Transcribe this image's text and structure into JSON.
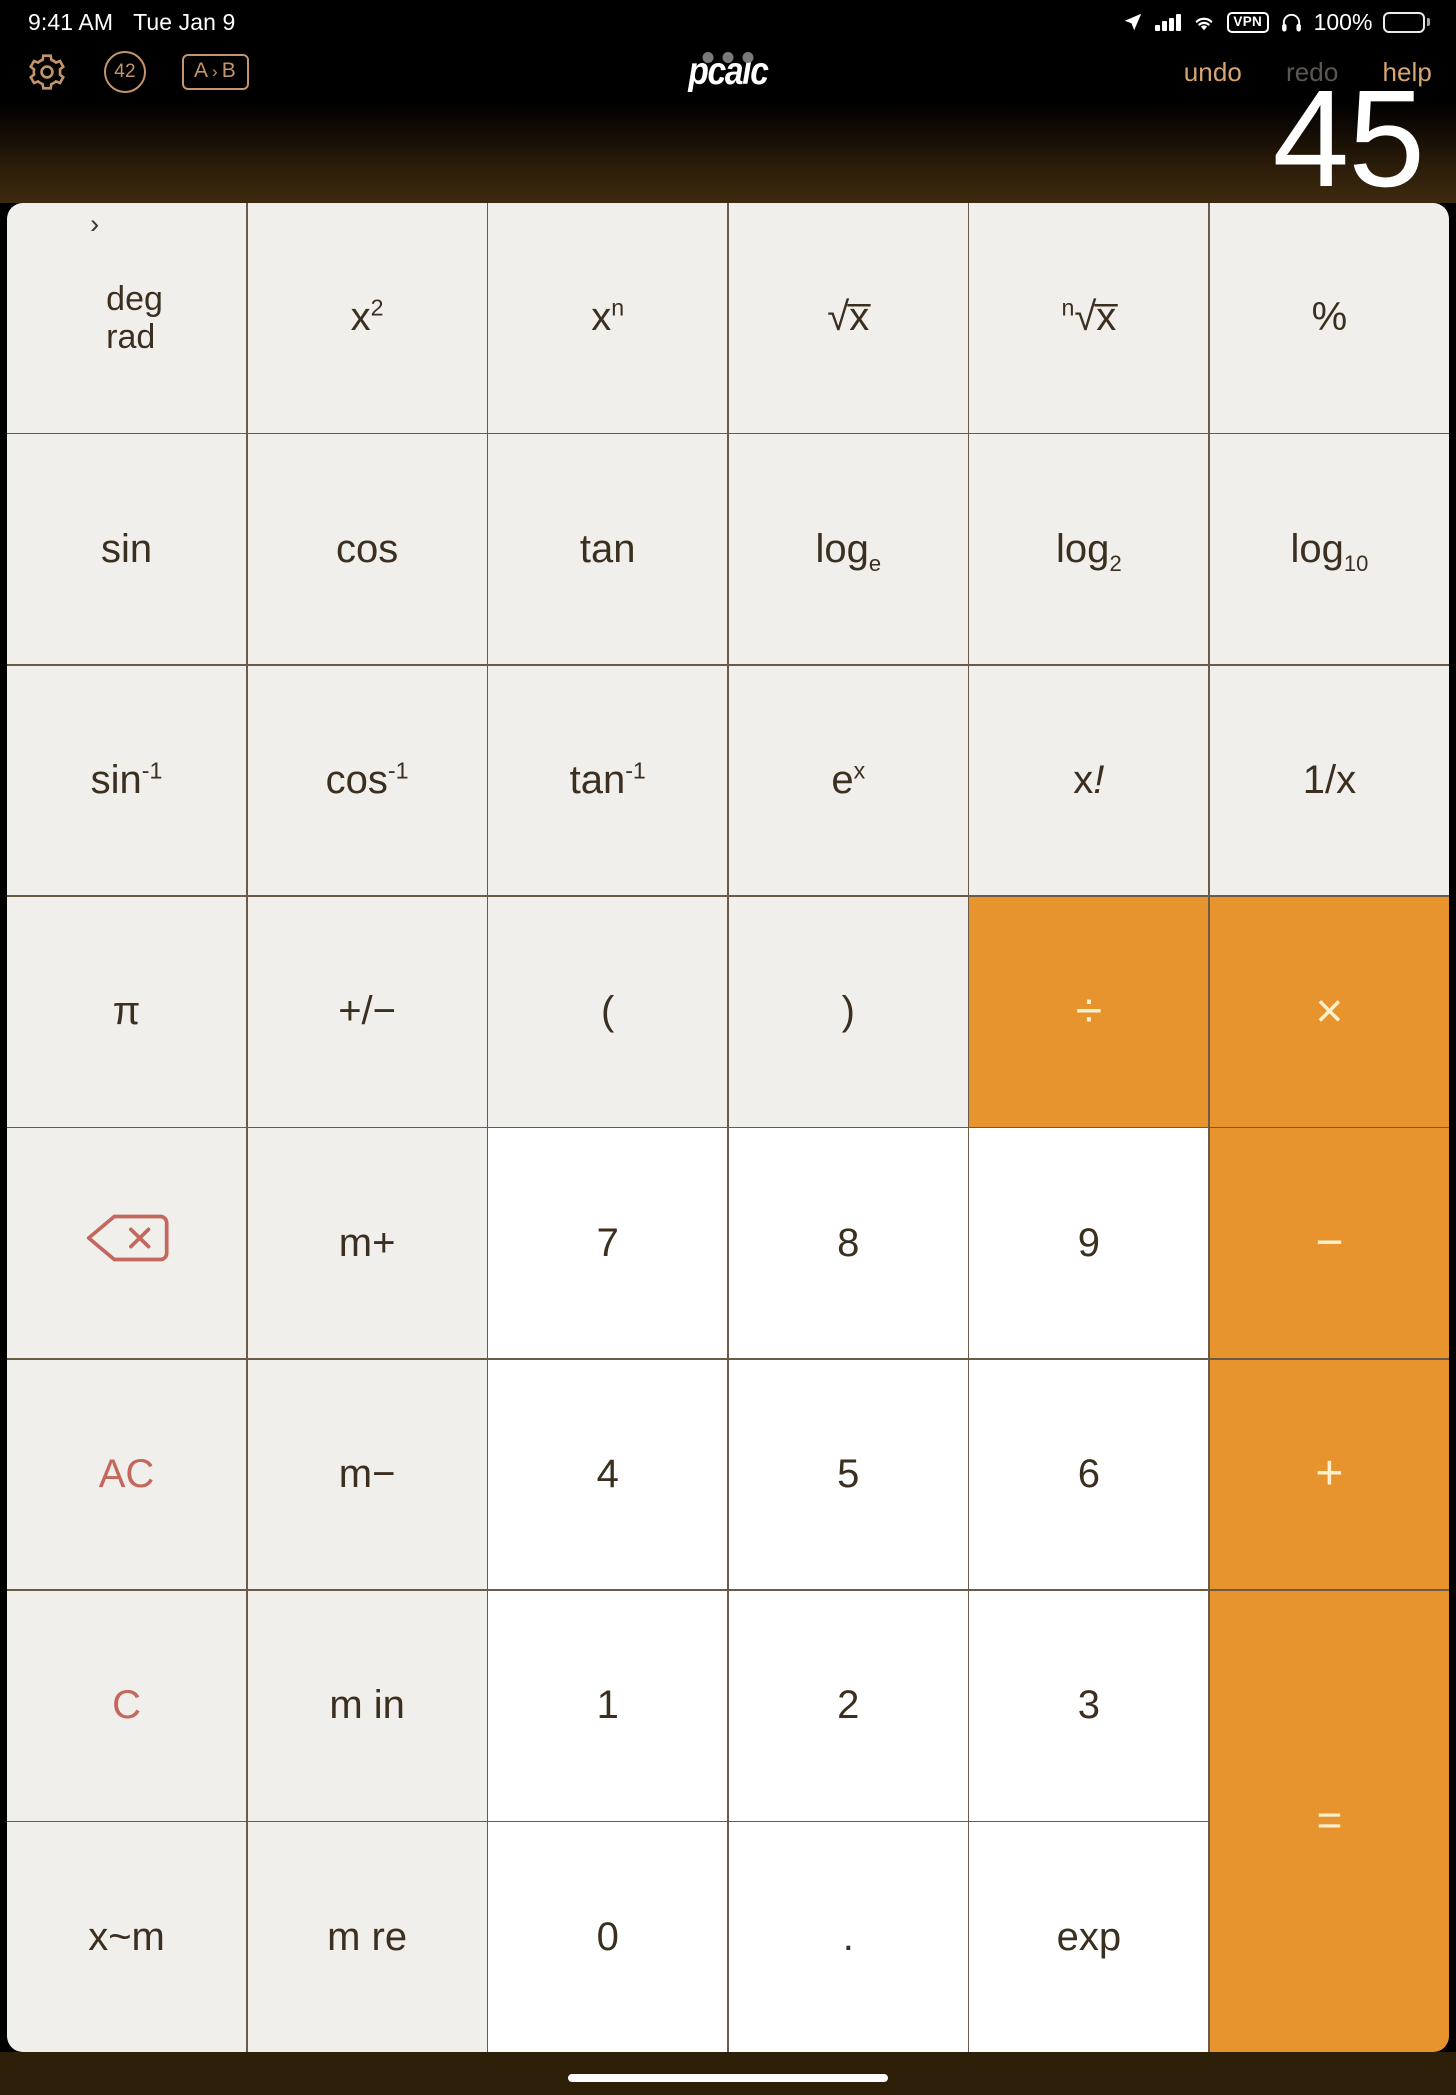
{
  "status_bar": {
    "time": "9:41 AM",
    "date": "Tue Jan 9",
    "battery_percent": "100%",
    "vpn_label": "VPN",
    "icons": [
      "location-arrow-icon",
      "cellular-signal-icon",
      "wifi-icon",
      "vpn-badge",
      "headphones-icon",
      "battery-icon"
    ]
  },
  "toolbar": {
    "settings_icon": "gear-icon",
    "constants_badge": "42",
    "conversion_label_a": "A",
    "conversion_chevron": "›",
    "conversion_label_b": "B",
    "app_title": "pcalc",
    "undo_label": "undo",
    "redo_label": "redo",
    "help_label": "help",
    "redo_disabled": true
  },
  "display": {
    "value": "45"
  },
  "colors": {
    "orange_key": "#e8942e",
    "orange_glyph": "#fdf0cf",
    "gray_key": "#f1efec",
    "white_key": "#ffffff",
    "key_text": "#3b2f20",
    "red_text": "#c4675c",
    "accent_tan": "#c4956b",
    "toolbar_tan": "#d8a472",
    "disabled_gray": "#5e5650",
    "grid_line": "#6a5b46",
    "bottom_bar": "#2e1f08"
  },
  "keypad": {
    "rows": [
      [
        {
          "name": "deg-rad-toggle",
          "type": "mode",
          "chevron": "›",
          "line1": "deg",
          "line2": "rad",
          "style": "gray"
        },
        {
          "name": "x-squared",
          "html": "x<sup>2</sup>",
          "style": "gray"
        },
        {
          "name": "x-to-the-n",
          "html": "x<sup>n</sup>",
          "style": "gray"
        },
        {
          "name": "square-root",
          "html": "√x̅",
          "style": "gray"
        },
        {
          "name": "nth-root",
          "html": "<sup>n</sup>√x̅",
          "style": "gray"
        },
        {
          "name": "percent",
          "html": "%",
          "style": "gray"
        }
      ],
      [
        {
          "name": "sin",
          "html": "sin",
          "style": "gray"
        },
        {
          "name": "cos",
          "html": "cos",
          "style": "gray"
        },
        {
          "name": "tan",
          "html": "tan",
          "style": "gray"
        },
        {
          "name": "log-e",
          "html": "log<sub>e</sub>",
          "style": "gray"
        },
        {
          "name": "log-2",
          "html": "log<sub>2</sub>",
          "style": "gray"
        },
        {
          "name": "log-10",
          "html": "log<sub>10</sub>",
          "style": "gray"
        }
      ],
      [
        {
          "name": "arcsin",
          "html": "sin<sup>-1</sup>",
          "style": "gray"
        },
        {
          "name": "arccos",
          "html": "cos<sup>-1</sup>",
          "style": "gray"
        },
        {
          "name": "arctan",
          "html": "tan<sup>-1</sup>",
          "style": "gray"
        },
        {
          "name": "e-to-the-x",
          "html": "e<sup>x</sup>",
          "style": "gray"
        },
        {
          "name": "factorial",
          "html": "x<i>!</i>",
          "style": "gray"
        },
        {
          "name": "reciprocal",
          "html": "1/x",
          "style": "gray"
        }
      ],
      [
        {
          "name": "pi",
          "html": "π",
          "style": "gray"
        },
        {
          "name": "plus-minus",
          "html": "+/−",
          "style": "gray"
        },
        {
          "name": "open-paren",
          "html": "(",
          "style": "gray"
        },
        {
          "name": "close-paren",
          "html": ")",
          "style": "gray"
        },
        {
          "name": "divide",
          "html": "÷",
          "style": "orange",
          "glyph": true
        },
        {
          "name": "multiply",
          "html": "×",
          "style": "orange",
          "glyph": true
        }
      ],
      [
        {
          "name": "backspace",
          "type": "backspace-icon",
          "style": "gray"
        },
        {
          "name": "memory-plus",
          "html": "m+",
          "style": "gray"
        },
        {
          "name": "digit-7",
          "html": "7",
          "style": "white"
        },
        {
          "name": "digit-8",
          "html": "8",
          "style": "white"
        },
        {
          "name": "digit-9",
          "html": "9",
          "style": "white"
        },
        {
          "name": "minus",
          "html": "−",
          "style": "orange",
          "glyph": true
        }
      ],
      [
        {
          "name": "all-clear",
          "html": "AC",
          "style": "gray",
          "red": true
        },
        {
          "name": "memory-minus",
          "html": "m−",
          "style": "gray"
        },
        {
          "name": "digit-4",
          "html": "4",
          "style": "white"
        },
        {
          "name": "digit-5",
          "html": "5",
          "style": "white"
        },
        {
          "name": "digit-6",
          "html": "6",
          "style": "white"
        },
        {
          "name": "plus",
          "html": "+",
          "style": "orange",
          "glyph": true
        }
      ],
      [
        {
          "name": "clear",
          "html": "C",
          "style": "gray",
          "red": true
        },
        {
          "name": "memory-in",
          "html": "m in",
          "style": "gray"
        },
        {
          "name": "digit-1",
          "html": "1",
          "style": "white"
        },
        {
          "name": "digit-2",
          "html": "2",
          "style": "white"
        },
        {
          "name": "digit-3",
          "html": "3",
          "style": "white"
        },
        {
          "name": "equals",
          "html": "=",
          "style": "orange",
          "glyph": true,
          "span_rows": 2
        }
      ],
      [
        {
          "name": "exchange-x-memory",
          "html": "x~m",
          "style": "gray"
        },
        {
          "name": "memory-recall",
          "html": "m re",
          "style": "gray"
        },
        {
          "name": "digit-0",
          "html": "0",
          "style": "white"
        },
        {
          "name": "decimal-point",
          "html": ".",
          "style": "white"
        },
        {
          "name": "exponent",
          "html": "exp",
          "style": "white"
        }
      ]
    ]
  }
}
